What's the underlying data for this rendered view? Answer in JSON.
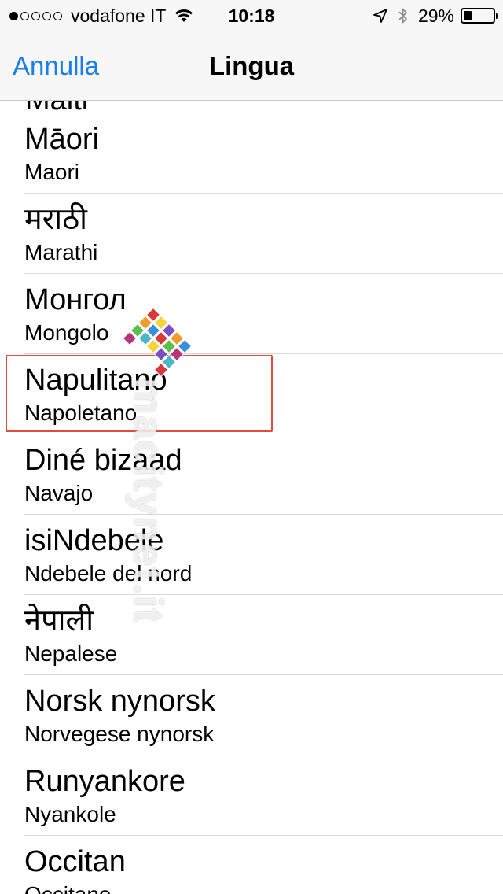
{
  "status_bar": {
    "carrier": "vodafone IT",
    "time": "10:18",
    "battery_percent": "29%",
    "signal_bars_filled": 1,
    "signal_bars_total": 5,
    "battery_level": 0.29,
    "icons": [
      "wifi-icon",
      "location-arrow-icon",
      "bluetooth-icon",
      "battery-icon"
    ]
  },
  "nav": {
    "cancel_label": "Annulla",
    "title": "Lingua"
  },
  "list": {
    "cut_top_item": "Malti",
    "items": [
      {
        "primary": "Māori",
        "secondary": "Maori"
      },
      {
        "primary": "मराठी",
        "secondary": "Marathi"
      },
      {
        "primary": "Монгол",
        "secondary": "Mongolo"
      },
      {
        "primary": "Napulitano",
        "secondary": "Napoletano",
        "highlighted": true
      },
      {
        "primary": "Diné bizaad",
        "secondary": "Navajo"
      },
      {
        "primary": "isiNdebele",
        "secondary": "Ndebele del nord"
      },
      {
        "primary": "नेपाली",
        "secondary": "Nepalese"
      },
      {
        "primary": "Norsk nynorsk",
        "secondary": "Norvegese nynorsk"
      },
      {
        "primary": "Runyankore",
        "secondary": "Nyankole"
      },
      {
        "primary": "Occitan",
        "secondary": "Occitano"
      }
    ]
  },
  "watermark": {
    "text": "macitynet.it",
    "colors": [
      "#d63a3a",
      "#f29a2e",
      "#f5d33a",
      "#5cbf4f",
      "#3a8fd6",
      "#7a4fc4",
      "#b8367a",
      "#4bb8c8"
    ]
  },
  "colors": {
    "accent": "#1a7df0",
    "highlight_border": "#e34b3b",
    "separator": "#d9d9dc",
    "bar_background": "#f7f7f7"
  }
}
